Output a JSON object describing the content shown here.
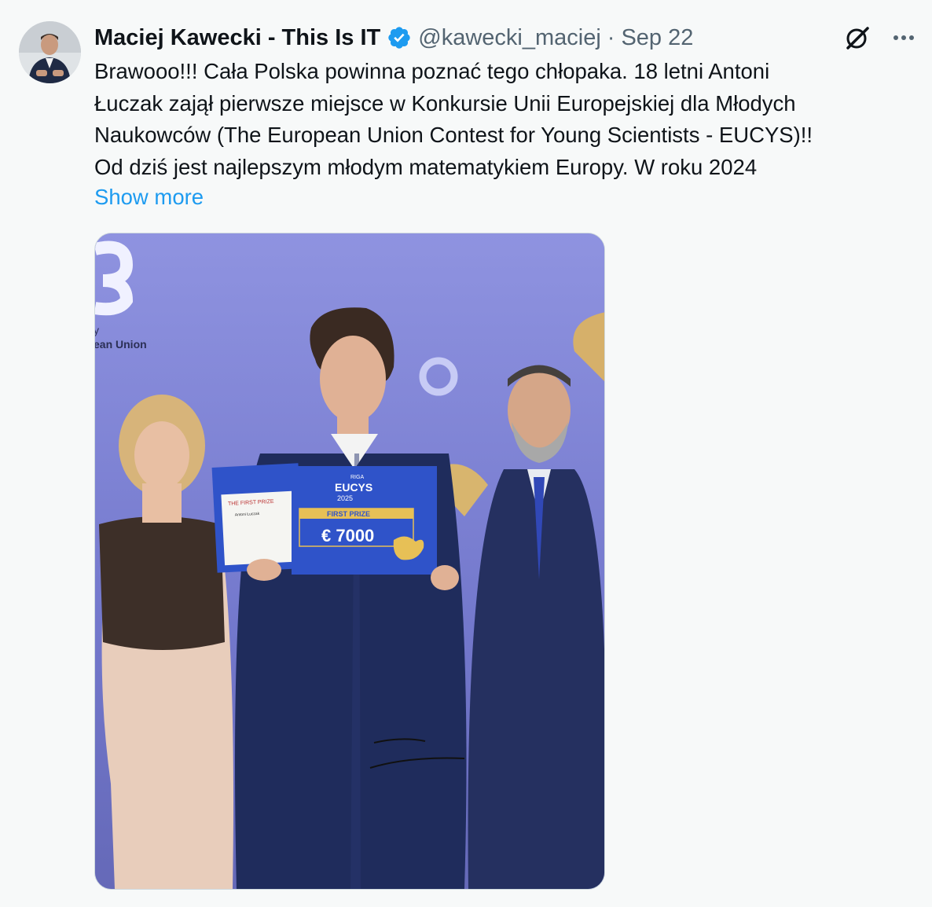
{
  "tweet": {
    "author_name": "Maciej Kawecki - This Is IT",
    "handle": "@kawecki_maciej",
    "separator": "·",
    "date": "Sep 22",
    "verified_icon": "verified-badge-icon",
    "text_lines": [
      "Brawooo!!! Cała Polska powinna poznać tego chłopaka. 18 letni Antoni",
      "Łuczak zajął pierwsze miejsce w Konkursie Unii Europejskiej dla Młodych",
      "Naukowców (The European Union Contest for Young Scientists - EUCYS)!!",
      "Od dziś jest najlepszym młodym matematykiem Europy. W roku 2024"
    ],
    "show_more": "Show more"
  },
  "colors": {
    "accent": "#1d9bf0",
    "text": "#0f1419",
    "muted": "#536471",
    "background": "#f7f9f9",
    "photo_backdrop": "#7a7fd1",
    "cheque_blue": "#2f53c9"
  },
  "photo": {
    "backdrop_text": "ean Union",
    "backdrop_y": "y",
    "certificate": {
      "title": "THE FIRST PRIZE",
      "name": "Antoni Łuczak"
    },
    "cheque": {
      "city": "RIGA",
      "logo": "EUCYS",
      "year": "2025",
      "prize_label": "FIRST PRIZE",
      "amount": "€ 7000"
    }
  }
}
